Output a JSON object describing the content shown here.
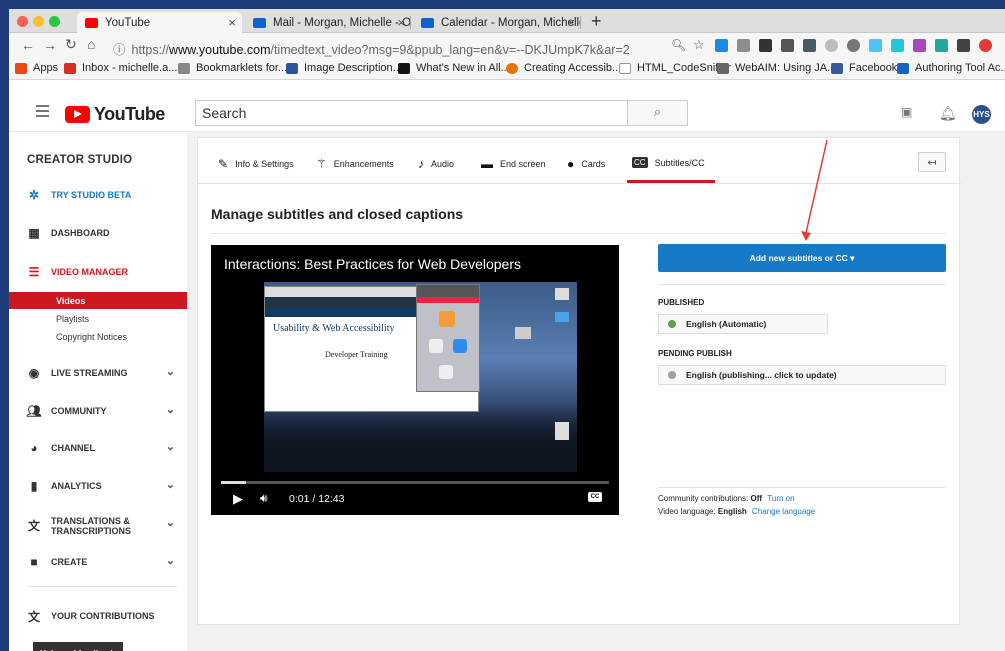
{
  "browser": {
    "tabs": [
      {
        "label": "YouTube",
        "color": "#ff0000"
      },
      {
        "label": "Mail - Morgan, Michelle - Outlo",
        "color": "#0a64d0"
      },
      {
        "label": "Calendar - Morgan, Michelle - ",
        "color": "#0a64d0"
      }
    ],
    "new_tab": "+",
    "url_prefix": "https://",
    "url_domain": "www.youtube.com",
    "url_path": "/timedtext_video?msg=9&ppub_lang=en&v=--DKJUmpK7k&ar=2",
    "bookmarks": [
      {
        "label": "Apps",
        "color": "#e64a19"
      },
      {
        "label": "Inbox - michelle.a...",
        "color": "#d93025"
      },
      {
        "label": "Bookmarklets for...",
        "color": "#888888"
      },
      {
        "label": "Image Description...",
        "color": "#2b5797"
      },
      {
        "label": "What's New in All...",
        "color": "#111111"
      },
      {
        "label": "Creating Accessib...",
        "color": "#e8710a"
      },
      {
        "label": "HTML_CodeSniffer",
        "color": "#999999"
      },
      {
        "label": "WebAIM: Using JA...",
        "color": "#666666"
      },
      {
        "label": "Facebook",
        "color": "#3b5998"
      },
      {
        "label": "Authoring Tool Ac...",
        "color": "#1565c0"
      }
    ]
  },
  "header": {
    "logo_text": "YouTube",
    "search_value": "Search",
    "avatar_initials": "HYS"
  },
  "sidebar": {
    "title": "CREATOR STUDIO",
    "items": [
      {
        "label": "TRY STUDIO BETA",
        "icon": "gear-icon"
      },
      {
        "label": "DASHBOARD",
        "icon": "dashboard-icon"
      },
      {
        "label": "VIDEO MANAGER",
        "icon": "video-manager-icon"
      },
      {
        "label": "LIVE STREAMING",
        "icon": "live-streaming-icon"
      },
      {
        "label": "COMMUNITY",
        "icon": "community-icon"
      },
      {
        "label": "CHANNEL",
        "icon": "channel-icon"
      },
      {
        "label": "ANALYTICS",
        "icon": "analytics-icon"
      },
      {
        "label": "TRANSLATIONS & TRANSCRIPTIONS",
        "icon": "translate-icon"
      },
      {
        "label": "CREATE",
        "icon": "create-icon"
      },
      {
        "label": "YOUR CONTRIBUTIONS",
        "icon": "contributions-icon"
      }
    ],
    "subitems": [
      "Videos",
      "Playlists",
      "Copyright Notices"
    ],
    "help_button": "Help and feedback"
  },
  "tabs": [
    {
      "label": "Info & Settings",
      "icon": "pencil-icon"
    },
    {
      "label": "Enhancements",
      "icon": "magic-wand-icon"
    },
    {
      "label": "Audio",
      "icon": "music-note-icon"
    },
    {
      "label": "End screen",
      "icon": "end-screen-icon"
    },
    {
      "label": "Cards",
      "icon": "info-icon"
    },
    {
      "label": "Subtitles/CC",
      "icon": "cc-icon"
    }
  ],
  "page_title": "Manage subtitles and closed captions",
  "video": {
    "title": "Interactions: Best Practices for Web Developers",
    "time": "0:01 / 12:43",
    "progress": 0.065,
    "cc_label": "CC",
    "screen_heading": "Usability & Web Accessibility",
    "screen_sub": "Developer Training"
  },
  "right_panel": {
    "add_button": "Add new subtitles or CC ▾",
    "published_label": "PUBLISHED",
    "published_lang": "English (Automatic)",
    "pending_label": "PENDING PUBLISH",
    "pending_lang": "English (publishing... click to update)",
    "community_label": "Community contributions:",
    "community_value": "Off",
    "community_link": "Turn on",
    "video_lang_label": "Video language:",
    "video_lang_value": "English",
    "video_lang_link": "Change language"
  },
  "colors": {
    "accent_red": "#cc181e",
    "button_blue": "#167ac6",
    "published_dot": "#5a9e4a",
    "pending_dot": "#9e9e9e"
  }
}
